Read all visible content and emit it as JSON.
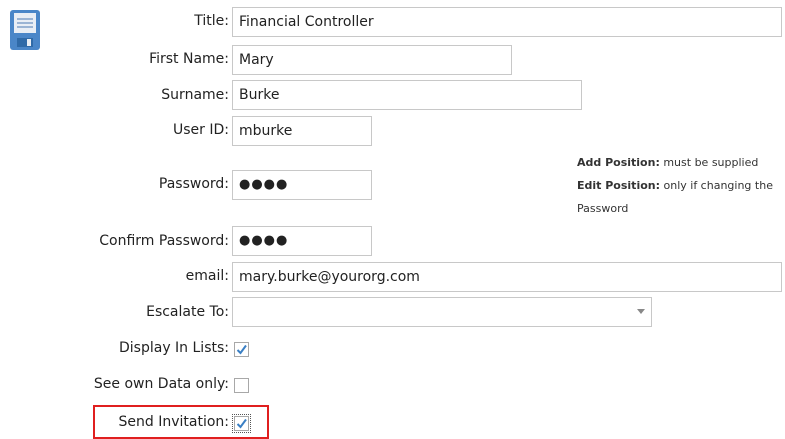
{
  "toolbar": {
    "save_icon": "floppy-disk-save-icon"
  },
  "form": {
    "title": {
      "label": "Title:",
      "value": "Financial Controller"
    },
    "first": {
      "label": "First Name:",
      "value": "Mary"
    },
    "surname": {
      "label": "Surname:",
      "value": "Burke"
    },
    "userid": {
      "label": "User ID:",
      "value": "mburke"
    },
    "password": {
      "label": "Password:",
      "value": "●●●●"
    },
    "confirm": {
      "label": "Confirm Password:",
      "value": "●●●●"
    },
    "email": {
      "label": "email:",
      "value": "mary.burke@yourorg.com"
    },
    "escalate": {
      "label": "Escalate To:",
      "value": ""
    },
    "display_in_lists": {
      "label": "Display In Lists:",
      "checked": true
    },
    "see_own_data": {
      "label": "See own Data only:",
      "checked": false
    },
    "send_invitation": {
      "label": "Send Invitation:",
      "checked": true
    }
  },
  "password_hint": {
    "add_bold": "Add Position:",
    "add_text": " must be supplied",
    "edit_bold": "Edit Position:",
    "edit_text": " only if changing the",
    "edit_text2": "Password"
  },
  "colors": {
    "accent": "#3a7fc4",
    "highlight": "#e01f1f",
    "icon": "#4a86c8"
  }
}
